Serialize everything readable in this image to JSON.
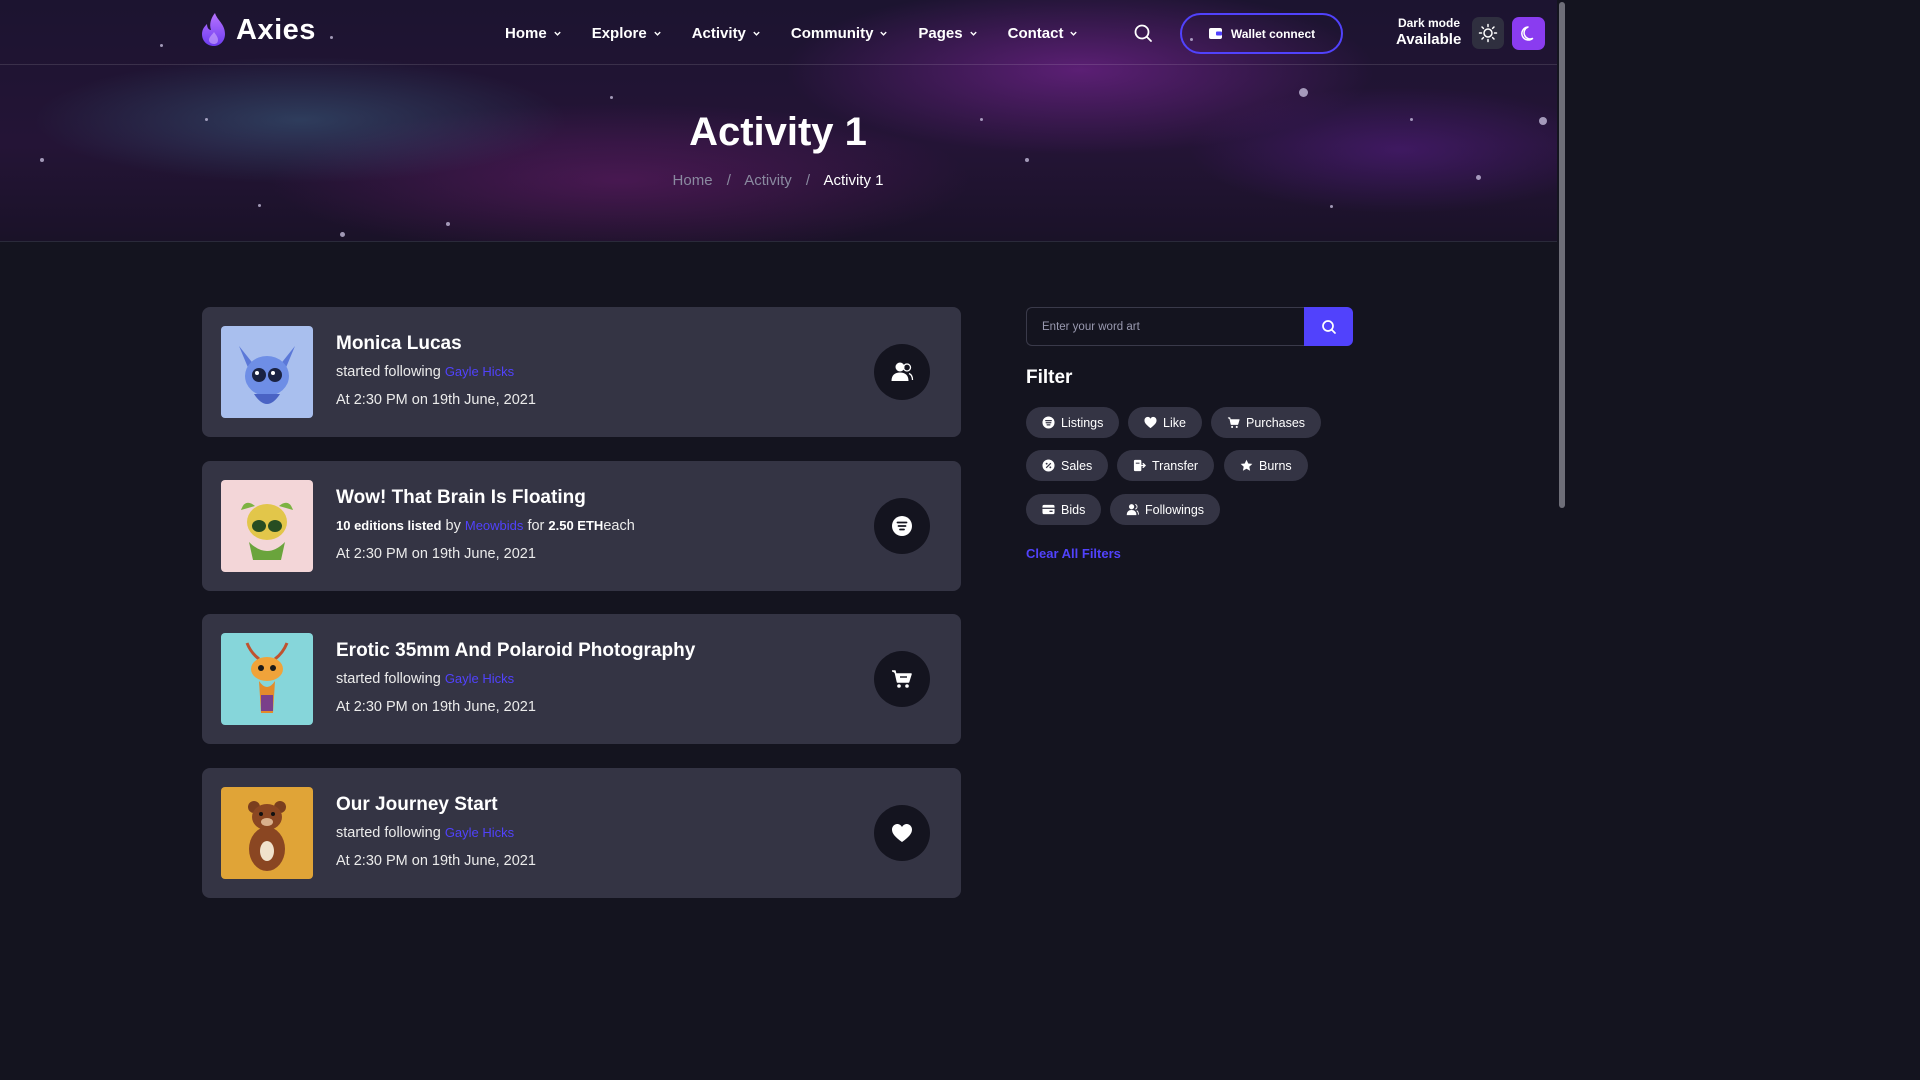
{
  "brand": {
    "name": "Axies",
    "accent": "#5142fc",
    "purple": "#8a3cf0"
  },
  "nav": {
    "items": [
      {
        "label": "Home"
      },
      {
        "label": "Explore"
      },
      {
        "label": "Activity"
      },
      {
        "label": "Community"
      },
      {
        "label": "Pages"
      },
      {
        "label": "Contact"
      }
    ],
    "wallet_label": "Wallet connect",
    "dark_mode_line1": "Dark mode",
    "dark_mode_line2": "Available"
  },
  "hero": {
    "title": "Activity 1",
    "breadcrumb": [
      "Home",
      "Activity",
      "Activity 1"
    ],
    "separator": "/"
  },
  "activities": [
    {
      "title": "Monica Lucas",
      "line_parts": [
        "started following",
        "Gayle Hicks"
      ],
      "time": "At 2:30 PM on 19th June, 2021",
      "action_icon": "users-icon",
      "thumb_bg": "#9fb6e6"
    },
    {
      "title": "Wow! That Brain Is Floating",
      "line_parts": [
        "10 editions listed",
        "by",
        "Meowbids",
        "for",
        "2.50 ETH",
        "each"
      ],
      "time": "At 2:30 PM on 19th June, 2021",
      "action_icon": "listing-icon",
      "thumb_bg": "#f1d3d6"
    },
    {
      "title": "Erotic 35mm And Polaroid Photography",
      "line_parts": [
        "started following",
        "Gayle Hicks"
      ],
      "time": "At 2:30 PM on 19th June, 2021",
      "action_icon": "cart-icon",
      "thumb_bg": "#7fd3d8"
    },
    {
      "title": "Our Journey Start",
      "line_parts": [
        "started following",
        "Gayle Hicks"
      ],
      "time": "At 2:30 PM on 19th June, 2021",
      "action_icon": "heart-icon",
      "thumb_bg": "#d99b2d"
    }
  ],
  "sidebar": {
    "search_placeholder": "Enter your word art",
    "filter_title": "Filter",
    "filters": [
      {
        "label": "Listings",
        "icon": "listing-icon"
      },
      {
        "label": "Like",
        "icon": "heart-icon"
      },
      {
        "label": "Purchases",
        "icon": "cart-icon"
      },
      {
        "label": "Sales",
        "icon": "sale-icon"
      },
      {
        "label": "Transfer",
        "icon": "transfer-icon"
      },
      {
        "label": "Burns",
        "icon": "star-icon"
      },
      {
        "label": "Bids",
        "icon": "wallet-icon"
      },
      {
        "label": "Followings",
        "icon": "users-icon"
      }
    ],
    "clear_label": "Clear All Filters"
  }
}
